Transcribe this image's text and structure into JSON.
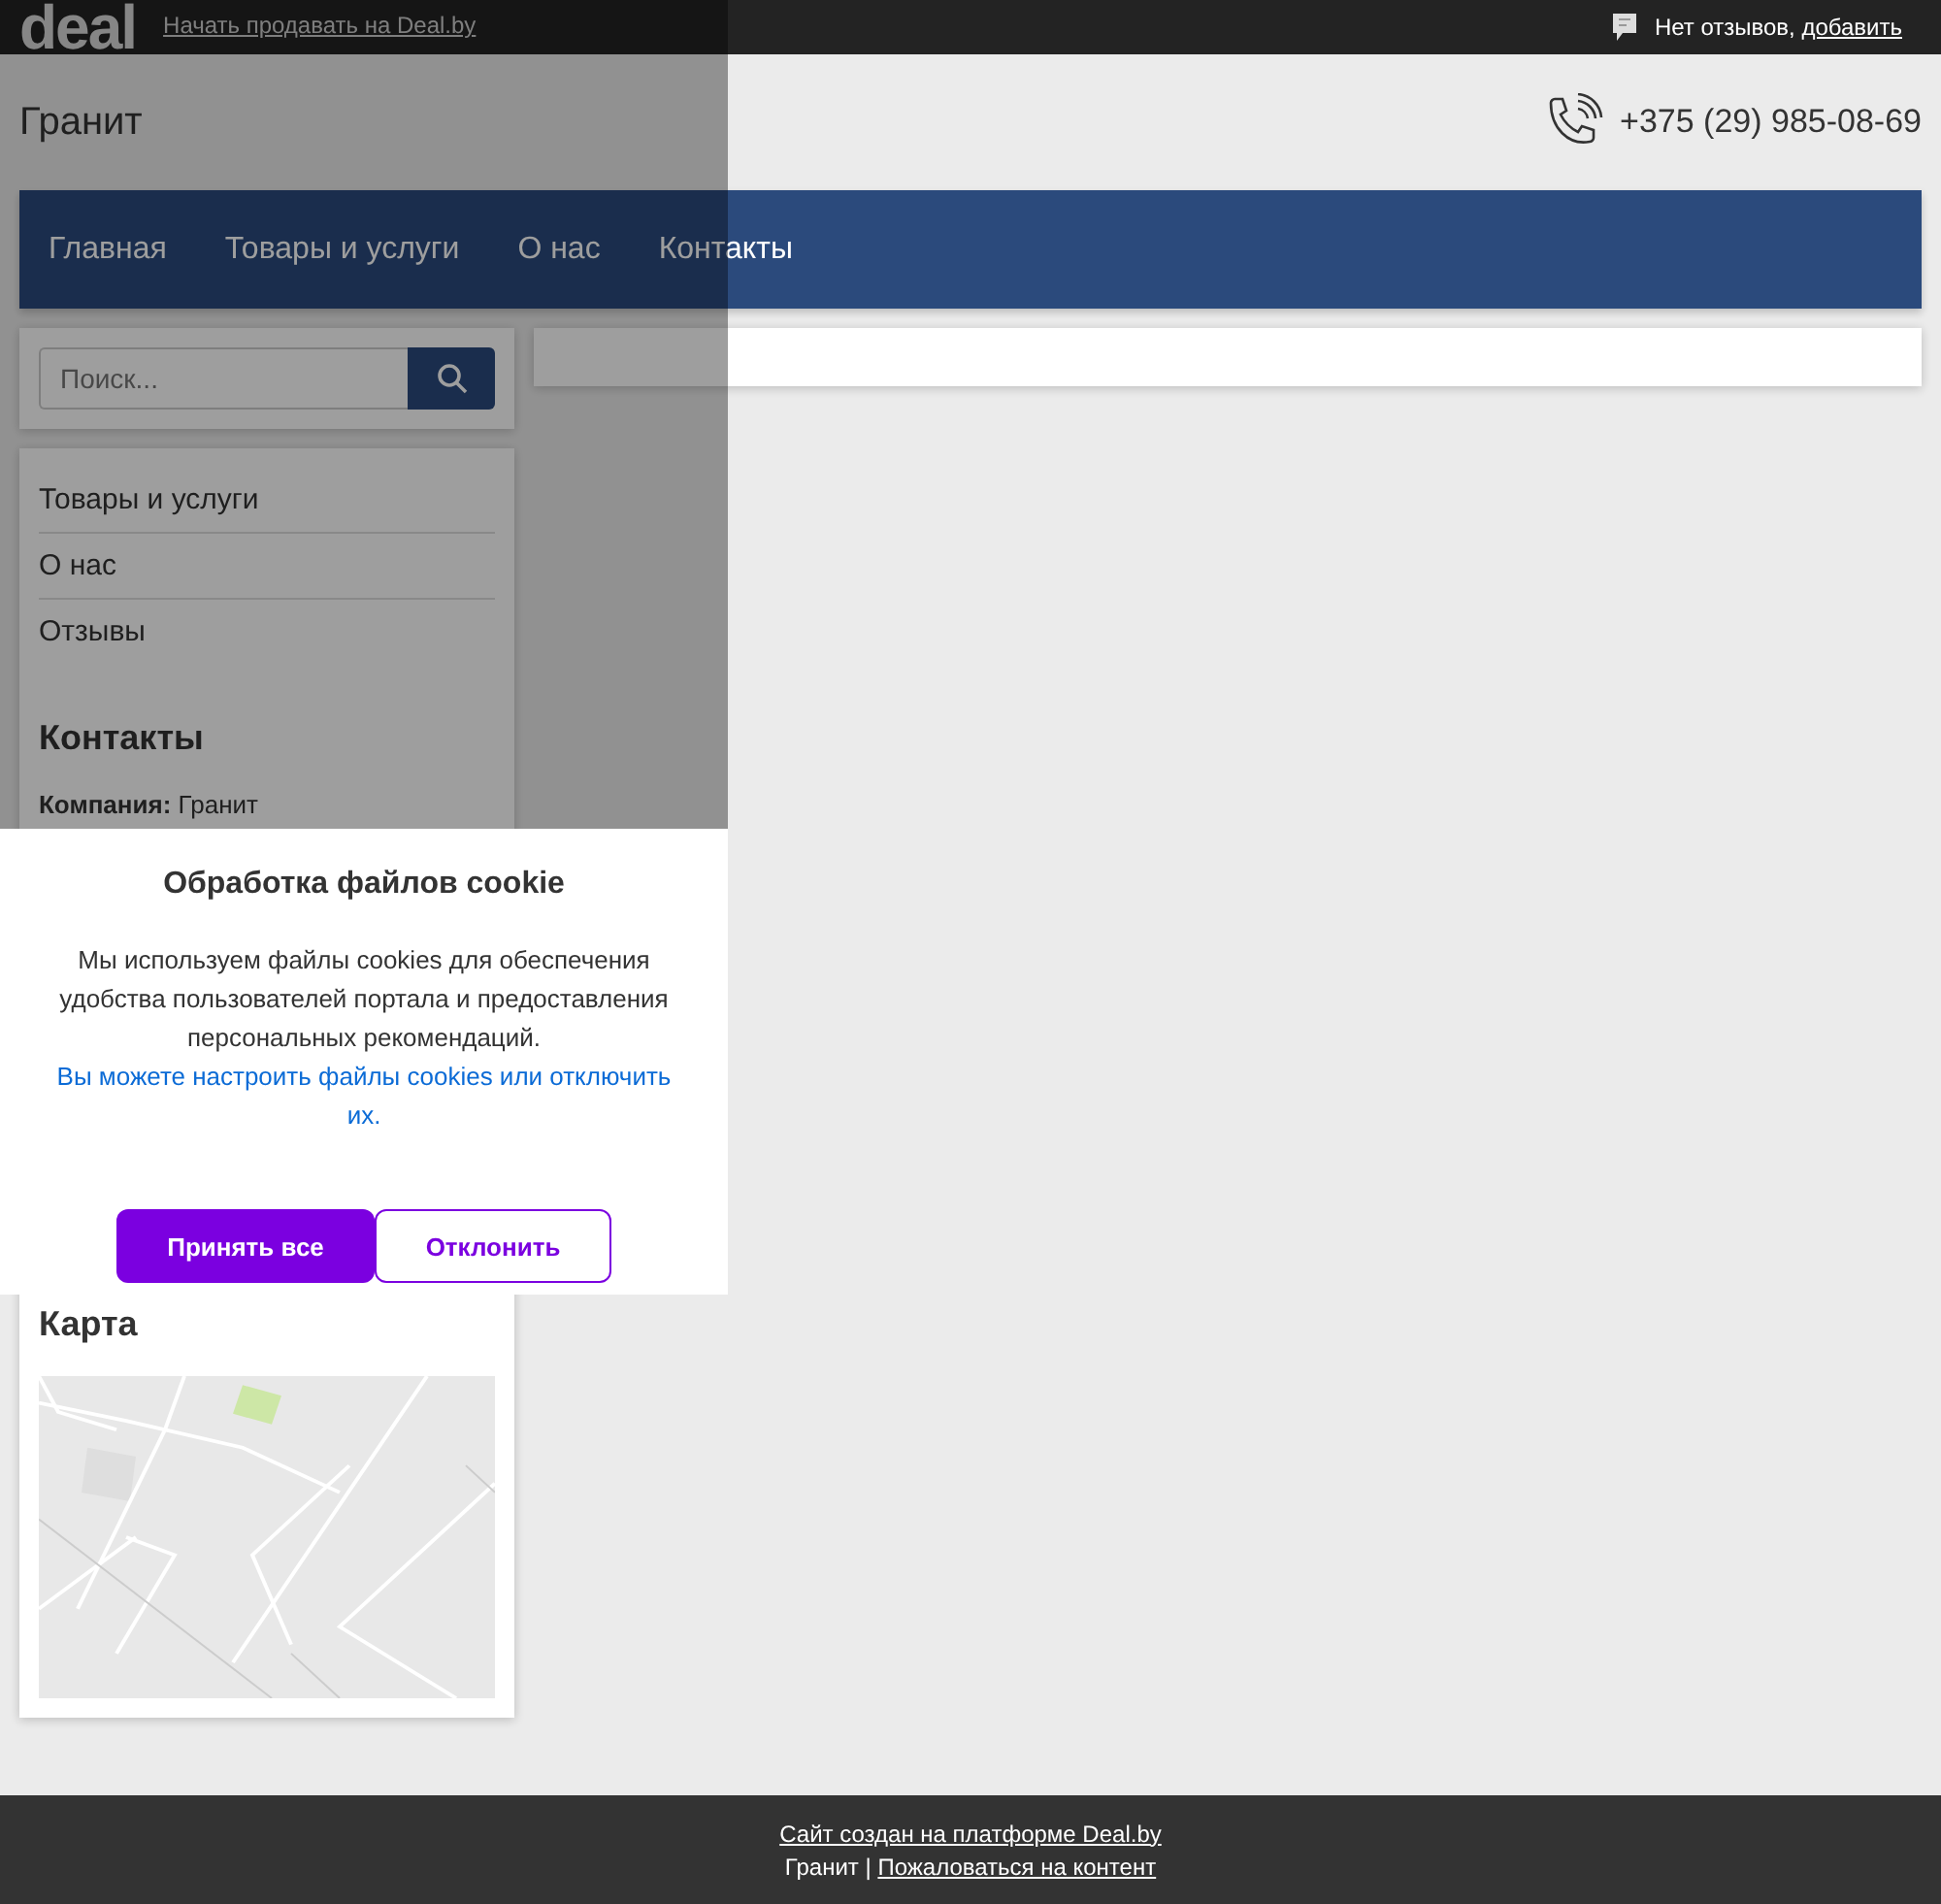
{
  "top_bar": {
    "logo": "deal",
    "sell_link": "Начать продавать на Deal.by",
    "reviews_text": "Нет отзывов,",
    "reviews_link": "добавить"
  },
  "header": {
    "company": "Гранит",
    "phone": "+375 (29) 985-08-69"
  },
  "nav": [
    "Главная",
    "Товары и услуги",
    "О нас",
    "Контакты"
  ],
  "search": {
    "placeholder": "Поиск..."
  },
  "sidebar": {
    "menu": [
      "Товары и услуги",
      "О нас",
      "Отзывы"
    ],
    "contacts_title": "Контакты",
    "company_label": "Компания:",
    "company_value": "Гранит",
    "map_title": "Карта"
  },
  "cookie_dialog": {
    "title": "Обработка файлов cookie",
    "text": "Мы используем файлы cookies для обеспечения удобства пользователей портала и предоставления персональных рекомендаций.",
    "link": "Вы можете настроить файлы cookies или отключить их.",
    "accept": "Принять все",
    "decline": "Отклонить"
  },
  "footer": {
    "platform_link": "Сайт создан на платформе Deal.by",
    "company": "Гранит |",
    "complaint_link": "Пожаловаться на контент"
  }
}
